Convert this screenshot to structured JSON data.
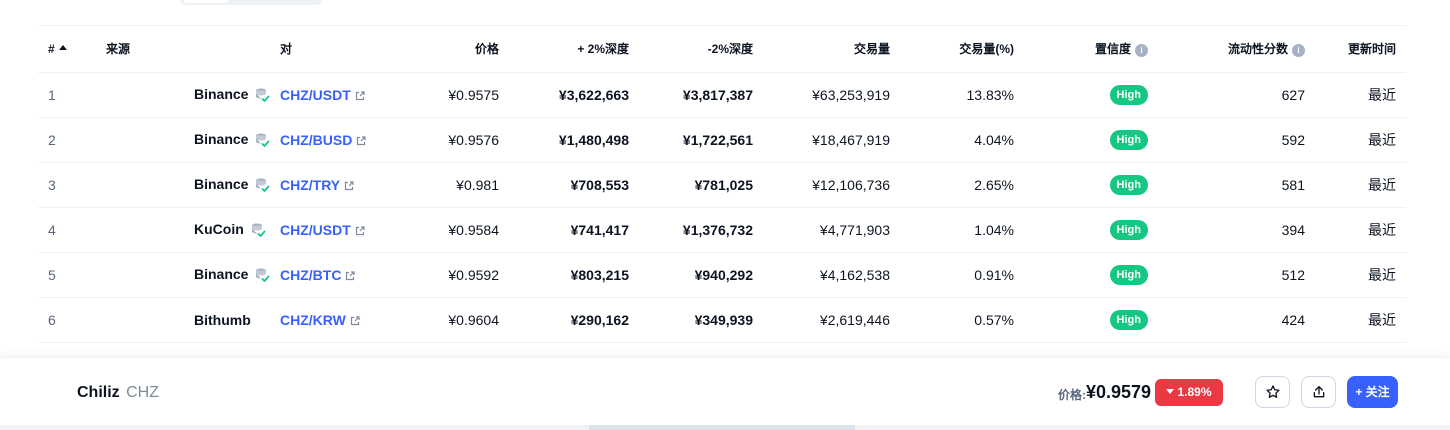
{
  "table": {
    "headers": {
      "rank": "#",
      "source": "来源",
      "pair": "对",
      "price": "价格",
      "depth_plus": "+ 2%深度",
      "depth_minus": "-2%深度",
      "volume": "交易量",
      "volume_pct": "交易量(%)",
      "confidence": "置信度",
      "liquidity": "流动性分数",
      "updated": "更新时间"
    },
    "rows": [
      {
        "rank": "1",
        "source": "Binance",
        "pair": "CHZ/USDT",
        "price": "¥0.9575",
        "depth_plus": "¥3,622,663",
        "depth_minus": "¥3,817,387",
        "volume": "¥63,253,919",
        "volume_pct": "13.83%",
        "confidence": "High",
        "liquidity": "627",
        "updated": "最近",
        "verified": true
      },
      {
        "rank": "2",
        "source": "Binance",
        "pair": "CHZ/BUSD",
        "price": "¥0.9576",
        "depth_plus": "¥1,480,498",
        "depth_minus": "¥1,722,561",
        "volume": "¥18,467,919",
        "volume_pct": "4.04%",
        "confidence": "High",
        "liquidity": "592",
        "updated": "最近",
        "verified": true
      },
      {
        "rank": "3",
        "source": "Binance",
        "pair": "CHZ/TRY",
        "price": "¥0.981",
        "depth_plus": "¥708,553",
        "depth_minus": "¥781,025",
        "volume": "¥12,106,736",
        "volume_pct": "2.65%",
        "confidence": "High",
        "liquidity": "581",
        "updated": "最近",
        "verified": true
      },
      {
        "rank": "4",
        "source": "KuCoin",
        "pair": "CHZ/USDT",
        "price": "¥0.9584",
        "depth_plus": "¥741,417",
        "depth_minus": "¥1,376,732",
        "volume": "¥4,771,903",
        "volume_pct": "1.04%",
        "confidence": "High",
        "liquidity": "394",
        "updated": "最近",
        "verified": true
      },
      {
        "rank": "5",
        "source": "Binance",
        "pair": "CHZ/BTC",
        "price": "¥0.9592",
        "depth_plus": "¥803,215",
        "depth_minus": "¥940,292",
        "volume": "¥4,162,538",
        "volume_pct": "0.91%",
        "confidence": "High",
        "liquidity": "512",
        "updated": "最近",
        "verified": true
      },
      {
        "rank": "6",
        "source": "Bithumb",
        "pair": "CHZ/KRW",
        "price": "¥0.9604",
        "depth_plus": "¥290,162",
        "depth_minus": "¥349,939",
        "volume": "¥2,619,446",
        "volume_pct": "0.57%",
        "confidence": "High",
        "liquidity": "424",
        "updated": "最近",
        "verified": false
      }
    ]
  },
  "footer": {
    "coin_name": "Chiliz",
    "coin_symbol": "CHZ",
    "price_label": "价格:",
    "price": "¥0.9579",
    "change": "1.89%",
    "follow_label": "+ 关注"
  },
  "colors": {
    "link": "#3861fb",
    "high_badge": "#16c784",
    "negative": "#ea3943",
    "muted": "#58667e"
  },
  "icons": {
    "verified": "shield-check-icon",
    "external": "external-link-icon",
    "info": "info-icon",
    "star": "star-icon",
    "share": "share-icon",
    "sort": "sort-up-icon",
    "change": "caret-down-icon"
  }
}
